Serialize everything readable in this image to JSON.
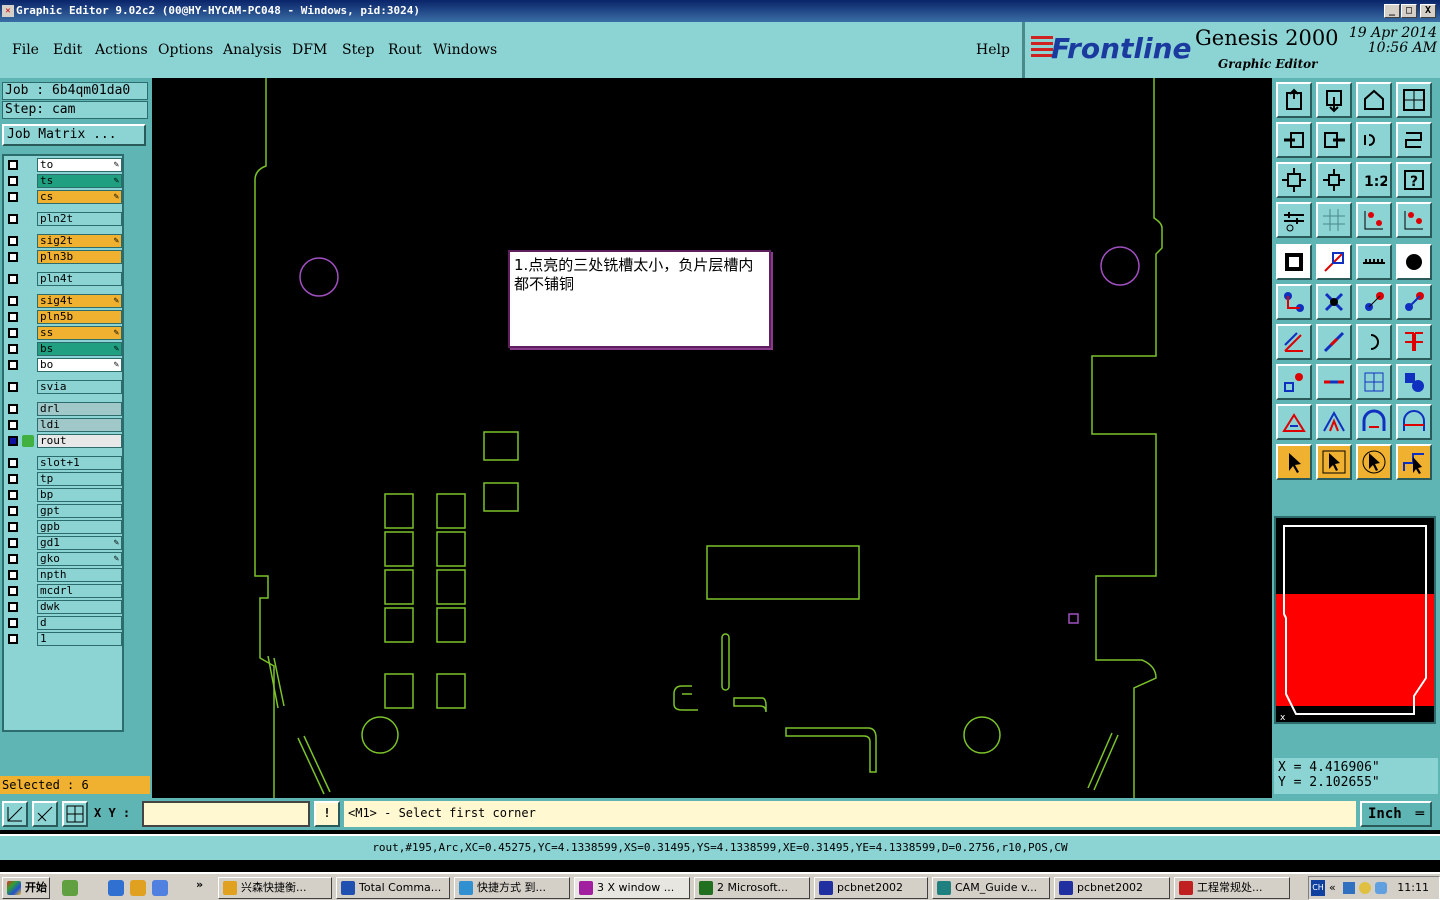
{
  "window": {
    "title": "Graphic Editor 9.02c2 (00@HY-HYCAM-PC048 - Windows, pid:3024)",
    "min": "_",
    "max": "□",
    "close": "X"
  },
  "menu": {
    "items": [
      "File",
      "Edit",
      "Actions",
      "Options",
      "Analysis",
      "DFM",
      "Step",
      "Rout",
      "Windows"
    ],
    "help": "Help"
  },
  "brand": {
    "logo": "Frontline",
    "product": "Genesis 2000",
    "subtitle": "Graphic Editor",
    "date": "19 Apr 2014",
    "time": "10:56 AM"
  },
  "job": {
    "job_label": "Job : 6b4qm01da0",
    "step_label": "Step: cam",
    "matrix_button": "Job Matrix ..."
  },
  "layers": [
    {
      "name": "to",
      "color": "#ffffff",
      "edit": true
    },
    {
      "name": "ts",
      "color": "#20a080",
      "edit": true
    },
    {
      "name": "cs",
      "color": "#f0b030",
      "edit": true
    },
    {
      "name": "pln2t",
      "color": "#8cd3d3",
      "edit": false
    },
    {
      "name": "sig2t",
      "color": "#f0b030",
      "edit": true
    },
    {
      "name": "pln3b",
      "color": "#f0b030",
      "edit": false
    },
    {
      "name": "pln4t",
      "color": "#8cd3d3",
      "edit": false
    },
    {
      "name": "sig4t",
      "color": "#f0b030",
      "edit": true
    },
    {
      "name": "pln5b",
      "color": "#f0b030",
      "edit": false
    },
    {
      "name": "ss",
      "color": "#f0b030",
      "edit": true
    },
    {
      "name": "bs",
      "color": "#20a080",
      "edit": true
    },
    {
      "name": "bo",
      "color": "#ffffff",
      "edit": true
    },
    {
      "name": "svia",
      "color": "#8cd3d3",
      "edit": false
    },
    {
      "name": "drl",
      "color": "#a0c8c8",
      "edit": false
    },
    {
      "name": "ldi",
      "color": "#a0c8c8",
      "edit": false
    },
    {
      "name": "rout",
      "color": "#e8e8e8",
      "edit": false,
      "active": true
    },
    {
      "name": "slot+1",
      "color": "#8cd3d3",
      "edit": false
    },
    {
      "name": "tp",
      "color": "#8cd3d3",
      "edit": false
    },
    {
      "name": "bp",
      "color": "#8cd3d3",
      "edit": false
    },
    {
      "name": "gpt",
      "color": "#8cd3d3",
      "edit": false
    },
    {
      "name": "gpb",
      "color": "#8cd3d3",
      "edit": false
    },
    {
      "name": "gd1",
      "color": "#8cd3d3",
      "edit": true
    },
    {
      "name": "gko",
      "color": "#8cd3d3",
      "edit": true
    },
    {
      "name": "npth",
      "color": "#8cd3d3",
      "edit": false
    },
    {
      "name": "mcdrl",
      "color": "#8cd3d3",
      "edit": false
    },
    {
      "name": "dwk",
      "color": "#8cd3d3",
      "edit": false
    },
    {
      "name": "d",
      "color": "#8cd3d3",
      "edit": false
    },
    {
      "name": "1",
      "color": "#8cd3d3",
      "edit": false
    }
  ],
  "selected": "Selected : 6",
  "memo": {
    "text": "1.点亮的三处铣槽太小，负片层槽内都不铺铜"
  },
  "coords": {
    "x": "X = 4.416906\"",
    "y": "Y = 2.102655\""
  },
  "command": {
    "xy_label": "X Y :",
    "xy_value": "",
    "prompt": "<M1> - Select first corner",
    "unit": "Inch",
    "warn_icon": "!"
  },
  "status": "rout,#195,Arc,XC=0.45275,YC=4.1338599,XS=0.31495,YS=4.1338599,XE=0.31495,YE=4.1338599,D=0.2756,r10,POS,CW",
  "taskbar": {
    "start": "开始",
    "more": "»",
    "items": [
      "兴森快捷衡...",
      "Total Comma...",
      "快捷方式 到...",
      "3 X window ...",
      "2 Microsoft...",
      "pcbnet2002",
      "CAM_Guide v...",
      "pcbnet2002",
      "工程常规处..."
    ],
    "clock": "11:11",
    "tray_lang": "CH",
    "tray_arrows": "«"
  },
  "colors": {
    "teal": "#8cd3d3",
    "orange": "#f0b030",
    "outline": "#7cc22a",
    "purple": "#a050c0"
  }
}
